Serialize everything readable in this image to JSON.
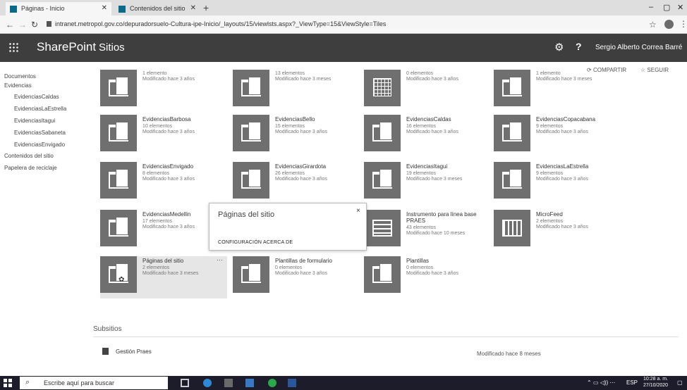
{
  "browser": {
    "tabs": [
      {
        "label": "Páginas - Inicio",
        "active": true
      },
      {
        "label": "Contenidos del sitio",
        "active": false
      }
    ],
    "new_tab": "+",
    "url": "intranet.metropol.gov.co/depuradorsuelo-Cultura-ipe-Inicio/_layouts/15/viewlsts.aspx?_ViewType=15&ViewStyle=Tiles",
    "minimize": "–",
    "restore": "▢",
    "close": "✕"
  },
  "suitebar": {
    "brand": "SharePoint",
    "section": "Sitios",
    "settings_icon": "⚙",
    "help_icon": "?",
    "user": "Sergio Alberto Correa Barré"
  },
  "actions": {
    "compartir": "COMPARTIR",
    "seguir": "SEGUIR"
  },
  "leftnav": [
    "Documentos",
    "Evidencias",
    "EvidenciasCaldas",
    "EvidenciasLaEstrella",
    "EvidenciasItagui",
    "EvidenciasSabaneta",
    "EvidenciasEnvigado",
    "Contenidos del sitio",
    "Papelera de reciclaje"
  ],
  "tiles": [
    {
      "title": "",
      "count": "1 elemento",
      "modified": "Modificado hace 3 años",
      "icon": "folder-icon"
    },
    {
      "title": "",
      "count": "13 elementos",
      "modified": "Modificado hace 3 meses",
      "icon": "folder-icon"
    },
    {
      "title": "",
      "count": "0 elementos",
      "modified": "Modificado hace 3 años",
      "icon": "grid-icon"
    },
    {
      "title": "",
      "count": "1 elemento",
      "modified": "Modificado hace 3 meses",
      "icon": "folder-icon"
    },
    {
      "title": "EvidenciasBarbosa",
      "count": "10 elementos",
      "modified": "Modificado hace 3 años",
      "icon": "folder-icon"
    },
    {
      "title": "EvidenciasBello",
      "count": "15 elementos",
      "modified": "Modificado hace 3 años",
      "icon": "folder-icon"
    },
    {
      "title": "EvidenciasCaldas",
      "count": "16 elementos",
      "modified": "Modificado hace 3 años",
      "icon": "folder-icon"
    },
    {
      "title": "EvidenciasCopacabana",
      "count": "9 elementos",
      "modified": "Modificado hace 3 años",
      "icon": "folder-icon"
    },
    {
      "title": "EvidenciasEnvigado",
      "count": "8 elementos",
      "modified": "Modificado hace 3 años",
      "icon": "folder-icon"
    },
    {
      "title": "EvidenciasGirardota",
      "count": "26 elementos",
      "modified": "Modificado hace 3 años",
      "icon": "folder-icon"
    },
    {
      "title": "EvidenciasItagui",
      "count": "19 elementos",
      "modified": "Modificado hace 3 meses",
      "icon": "folder-icon"
    },
    {
      "title": "EvidenciasLaEstrella",
      "count": "9 elementos",
      "modified": "Modificado hace 3 años",
      "icon": "folder-icon"
    },
    {
      "title": "EvidenciasMedellin",
      "count": "17 elementos",
      "modified": "Modificado hace 3 años",
      "icon": "folder-icon"
    },
    {
      "title": "",
      "count": "",
      "modified": "",
      "icon": "folder-icon"
    },
    {
      "title": "Instrumento para línea base PRAES",
      "count": "43 elementos",
      "modified": "Modificado hace 10 meses",
      "icon": "list-icon"
    },
    {
      "title": "MicroFeed",
      "count": "2 elementos",
      "modified": "Modificado hace 3 años",
      "icon": "calendar-icon"
    },
    {
      "title": "Páginas del sitio",
      "count": "2 elementos",
      "modified": "Modificado hace 3 meses",
      "icon": "site-pages-icon",
      "more": "···"
    },
    {
      "title": "Plantillas de formulario",
      "count": "0 elementos",
      "modified": "Modificado hace 3 años",
      "icon": "folder-icon"
    },
    {
      "title": "Plantillas",
      "count": "0 elementos",
      "modified": "Modificado hace 3 años",
      "icon": "folder-icon"
    }
  ],
  "callout": {
    "title": "Páginas del sitio",
    "close": "×",
    "link_config": "CONFIGURACIÓN",
    "link_about": "ACERCA DE"
  },
  "subsites": {
    "heading": "Subsitios",
    "items": [
      {
        "name": "Gestión Praes",
        "modified": "Modificado hace 8 meses"
      }
    ]
  },
  "taskbar": {
    "search_placeholder": "Escribe aquí para buscar",
    "language": "ESP",
    "time": "10:28 a. m.",
    "date": "27/10/2020"
  }
}
